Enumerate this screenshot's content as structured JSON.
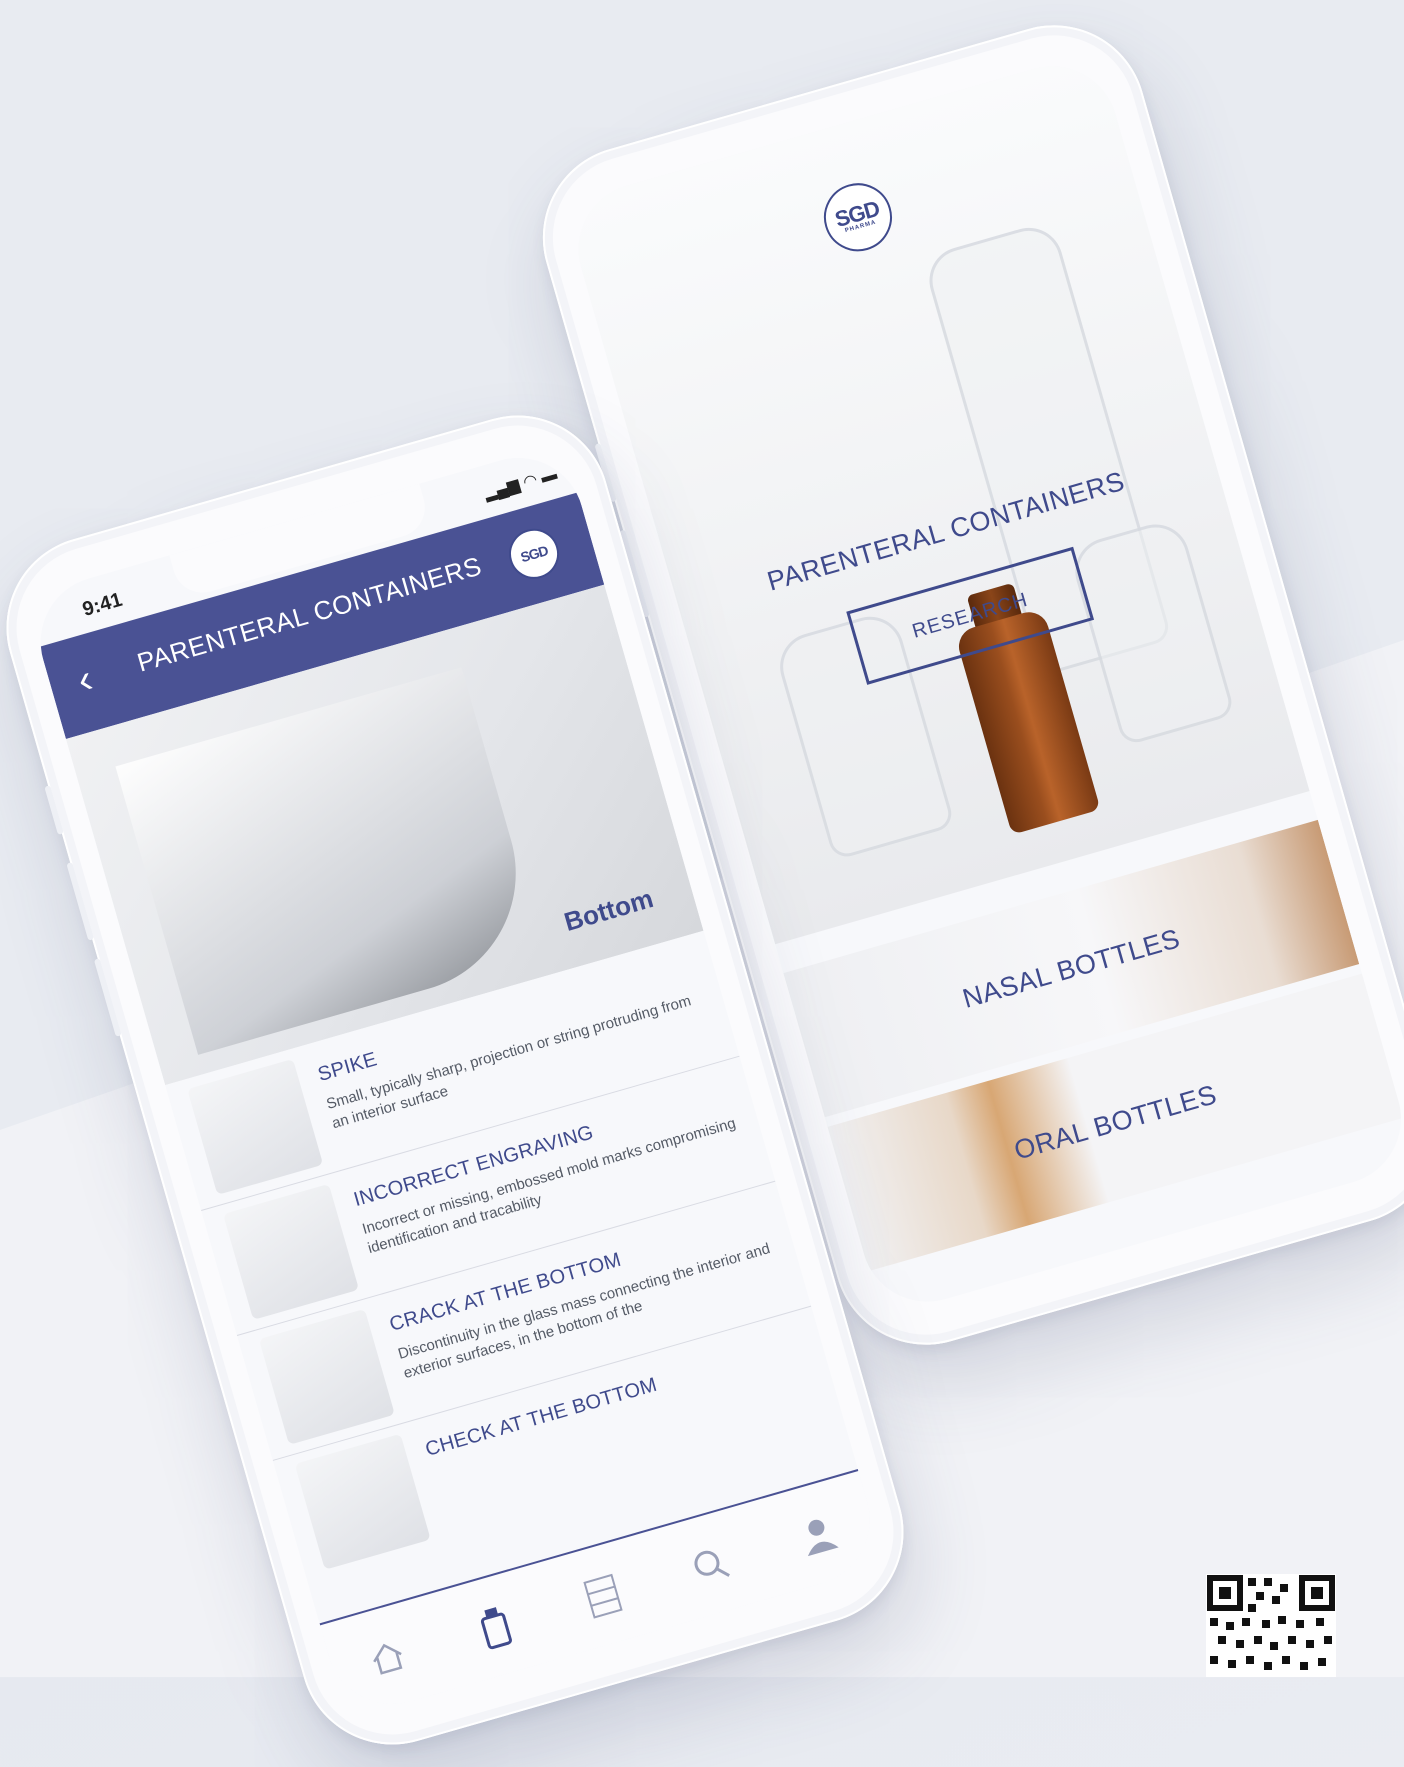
{
  "right_screen": {
    "logo_main": "SGD",
    "logo_sub": "PHARMA",
    "hero_title": "PARENTERAL CONTAINERS",
    "research_button": "RESEARCH",
    "categories": [
      "NASAL BOTTLES",
      "ORAL BOTTLES"
    ]
  },
  "left_screen": {
    "status_time": "9:41",
    "header_title": "PARENTERAL CONTAINERS",
    "back_icon": "chevron-left-icon",
    "logo_main": "SGD",
    "hero_label": "Bottom",
    "defects": [
      {
        "title": "SPIKE",
        "description": "Small, typically sharp, projection or string protruding from an interior surface"
      },
      {
        "title": "INCORRECT ENGRAVING",
        "description": "Incorrect or missing, embossed mold marks compromising identification and tracability"
      },
      {
        "title": "CRACK AT THE BOTTOM",
        "description": "Discontinuity in the glass mass connecting the interior and exterior surfaces, in the bottom of the"
      },
      {
        "title": "CHECK AT THE BOTTOM",
        "description": ""
      }
    ],
    "tabs": [
      "home-icon",
      "bottle-icon",
      "catalog-icon",
      "search-icon",
      "profile-icon"
    ]
  },
  "colors": {
    "brand": "#4a5294",
    "amber": "#9a4e1e",
    "background": "#eceef3"
  }
}
